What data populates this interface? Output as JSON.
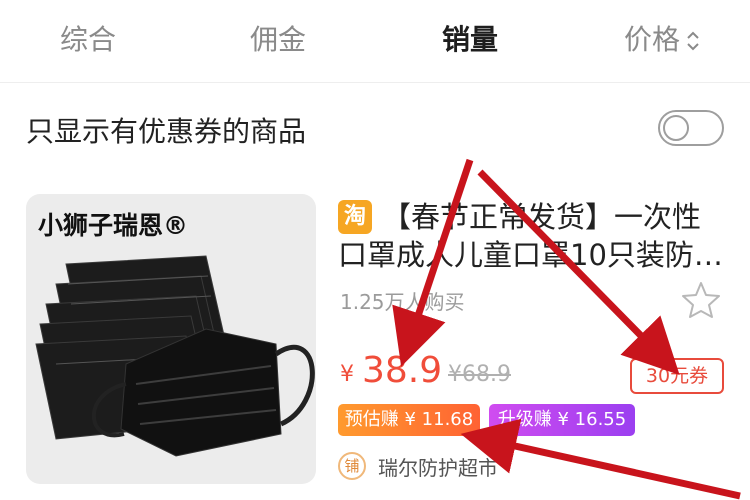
{
  "tabs": [
    {
      "label": "综合"
    },
    {
      "label": "佣金"
    },
    {
      "label": "销量"
    },
    {
      "label": "价格",
      "icon": "sort-icon"
    }
  ],
  "filter": {
    "label": "只显示有优惠券的商品",
    "toggle_on": false
  },
  "product": {
    "brand": "小狮子瑞恩®",
    "platform_badge": "淘",
    "title": "【春节正常发货】一次性口罩成人儿童口罩10只装防…",
    "sales": "1.25万人购买",
    "price_symbol": "¥",
    "price": "38.9",
    "original_price": "¥68.9",
    "coupon": "30元券",
    "estimated_earn": "预估赚 ¥ 11.68",
    "upgrade_earn": "升级赚 ¥ 16.55",
    "shop_icon": "铺",
    "shop_name": "瑞尔防护超市"
  },
  "colors": {
    "accent": "#f04d3a",
    "annotation_arrow": "#c8141c"
  }
}
